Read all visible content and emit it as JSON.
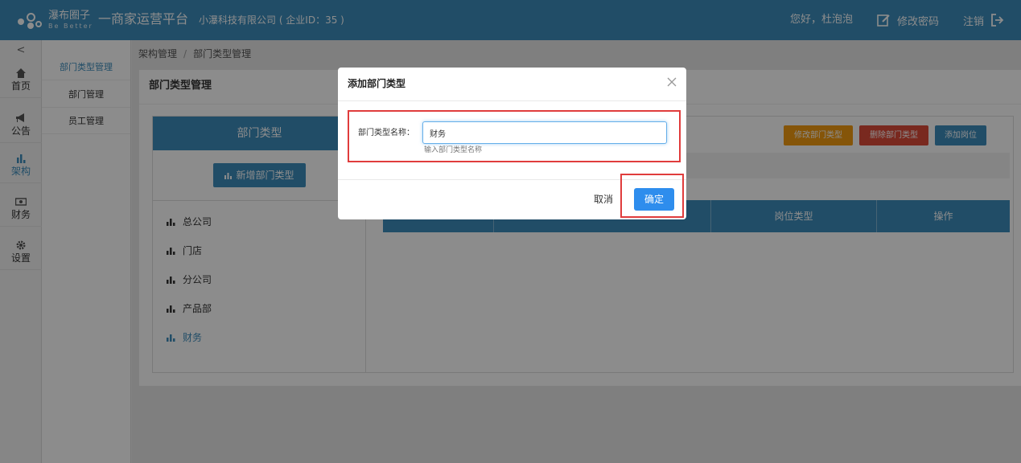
{
  "header": {
    "brand_name": "瀑布圈子",
    "slogan": "Be Better",
    "platform_title": "一商家运营平台",
    "company": "小瀑科技有限公司 ( 企业ID：35 )",
    "greeting": "您好，杜泡泡",
    "change_password": "修改密码",
    "logout": "注销"
  },
  "sidebar": {
    "collapse": "<",
    "items": [
      {
        "label": "首页",
        "icon": "home-icon"
      },
      {
        "label": "公告",
        "icon": "bullhorn-icon"
      },
      {
        "label": "架构",
        "icon": "bar-chart-icon"
      },
      {
        "label": "财务",
        "icon": "money-icon"
      },
      {
        "label": "设置",
        "icon": "gear-icon"
      }
    ],
    "active_index": 2
  },
  "submenu": {
    "items": [
      "部门类型管理",
      "部门管理",
      "员工管理"
    ],
    "active_index": 0
  },
  "breadcrumb": {
    "parent": "架构管理",
    "separator": "/",
    "current": "部门类型管理"
  },
  "panel": {
    "title": "部门类型管理",
    "dept_types_heading": "部门类型",
    "add_dept_type_button": "新增部门类型",
    "dept_types": [
      "总公司",
      "门店",
      "分公司",
      "产品部",
      "财务"
    ],
    "active_dept_index": 4,
    "actions": {
      "edit": "修改部门类型",
      "delete": "删除部门类型",
      "add_position": "添加岗位"
    },
    "table_headers": [
      "",
      "",
      "岗位类型",
      "操作"
    ]
  },
  "modal": {
    "title": "添加部门类型",
    "field_label": "部门类型名称：",
    "field_value": "财务",
    "help_text": "输入部门类型名称",
    "cancel": "取消",
    "confirm": "确定"
  },
  "colors": {
    "primary": "#3c8dbc",
    "warning": "#f39c12",
    "danger": "#dd4b39",
    "highlight": "#e03c3c"
  }
}
